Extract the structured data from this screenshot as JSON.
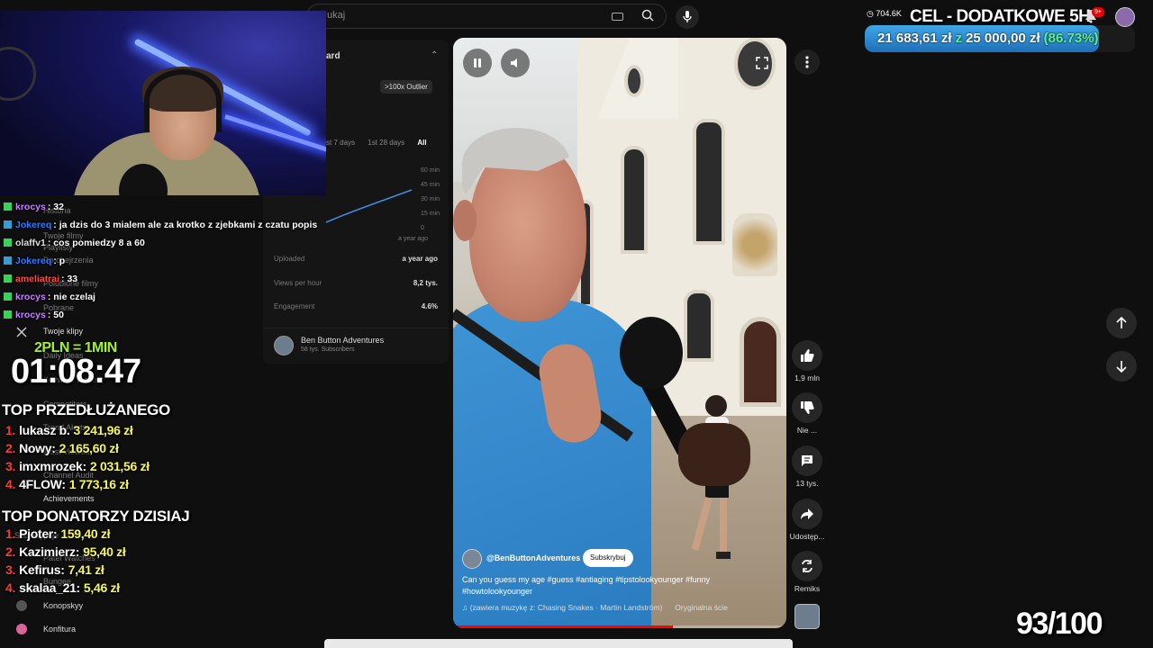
{
  "search": {
    "placeholder": "ukaj"
  },
  "analytics": {
    "title": "ard",
    "outlier": ">100x Outlier",
    "tabs": [
      "st 7 days",
      "1st 28 days",
      "All"
    ],
    "y_ticks": [
      "60 min",
      "45 min",
      "30 min",
      "15 min",
      "0"
    ],
    "x_tick": "a year ago",
    "stats": [
      {
        "label": "Uploaded",
        "value": "a year ago"
      },
      {
        "label": "Views per hour",
        "value": "8,2 tys."
      },
      {
        "label": "Engagement",
        "value": "4.6%"
      }
    ],
    "channel": {
      "name": "Ben Button Adventures",
      "subs": "58 tys. Subscribers"
    }
  },
  "sidebar": {
    "items": [
      "Historia",
      "Twoje filmy",
      "Playlisty",
      "Do obejrzenia",
      "Polubione filmy",
      "Pobrane",
      "Twoje klipy",
      "Daily Ideas",
      "Keyword Inspect",
      "Competitors",
      "Trend Alerts",
      "Most Viewed",
      "Channel Audit",
      "Achievements",
      "Subskrypcje",
      "Patel Watches",
      "Bungee",
      "Konopskyy",
      "Konfitura"
    ]
  },
  "video": {
    "channel": "@BenButtonAdventures",
    "subscribe": "Subskrybuj",
    "title": "Can you guess my age #guess #antiaging #tipstolookyounger #funny #howtolookyounger",
    "music": "(zawiera muzykę z: Chasing Snakes · Martin Landström)",
    "music_orig": "Oryginalna ście",
    "progress": 0.66
  },
  "actions": {
    "likes": "1,9 mln",
    "dislike": "Nie ...",
    "comments": "13 tys.",
    "share": "Udostęp...",
    "remix": "Remiks"
  },
  "overlay": {
    "chat": [
      {
        "user": "krocys",
        "msg": ": 32",
        "color": "#c882ff",
        "badge": "#3ad15a"
      },
      {
        "user": "Jokereq",
        "msg": ": ja dzis do 3 mialem ale za krotko z zjebkami z czatu popis",
        "color": "#2f7bff",
        "badge": "#3a9bd5"
      },
      {
        "user": "olaffv1",
        "msg": ": cos pomiedzy 8 a 60",
        "color": "#ddd",
        "badge": "#3ad15a"
      },
      {
        "user": "Jokereq",
        "msg": ": p",
        "color": "#2f7bff",
        "badge": "#3a9bd5"
      },
      {
        "user": "ameliatrai",
        "msg": ": 33",
        "color": "#ff4a4a",
        "badge": "#3ad15a"
      },
      {
        "user": "krocys",
        "msg": ": nie czelaj",
        "color": "#c882ff",
        "badge": "#3ad15a"
      },
      {
        "user": "krocys",
        "msg": ": 50",
        "color": "#c882ff",
        "badge": "#3ad15a"
      }
    ],
    "timer_rate": "2PLN = 1MIN",
    "timer": "01:08:47",
    "top_extended_title": "TOP PRZEDŁUŻANEGO",
    "top_extended": [
      {
        "rank": "1.",
        "name": "lukasz b.",
        "amount": "3 241,96 zł"
      },
      {
        "rank": "2.",
        "name": "Nowy:",
        "amount": "2 165,60 zł"
      },
      {
        "rank": "3.",
        "name": "imxmrozek:",
        "amount": "2 031,56 zł"
      },
      {
        "rank": "4.",
        "name": "4FLOW:",
        "amount": "1 773,16 zł"
      }
    ],
    "top_donors_title": "TOP DONATORZY DZISIAJ",
    "top_donors": [
      {
        "rank": "1.",
        "name": "Pjoter:",
        "amount": "159,40 zł"
      },
      {
        "rank": "2.",
        "name": "Kazimierz:",
        "amount": "95,40 zł"
      },
      {
        "rank": "3.",
        "name": "Kefirus:",
        "amount": "7,41 zł"
      },
      {
        "rank": "4.",
        "name": "skalaa_21:",
        "amount": "5,46 zł"
      }
    ],
    "views": "704.6K",
    "goal_title": "CEL - DODATKOWE 5H",
    "goal_current": "21 683,61 zł",
    "goal_z": "z",
    "goal_total": "25 000,00 zł",
    "goal_pct": "(86.73%)",
    "goal_fraction": 0.8673,
    "notif_count": "9+",
    "counter": "93/100"
  }
}
